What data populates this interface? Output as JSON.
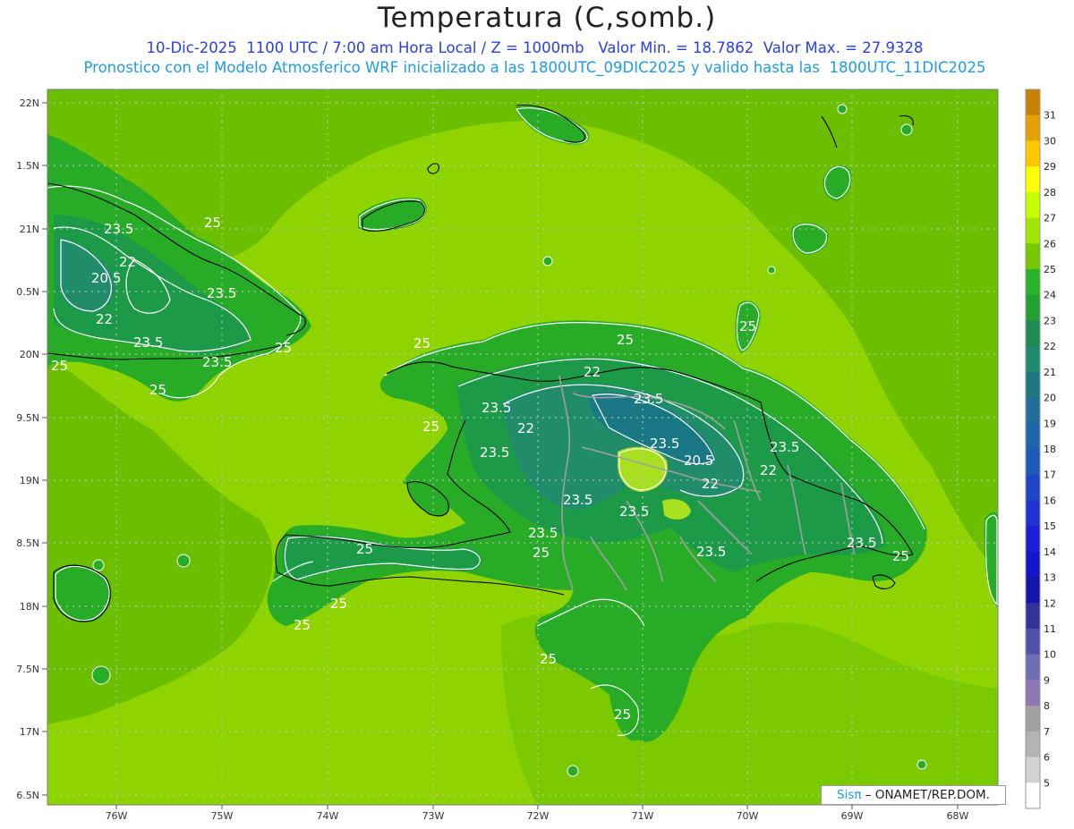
{
  "header": {
    "title": "Temperatura (C,somb.)",
    "line1": "10-Dic-2025  1100 UTC / 7:00 am Hora Local / Z = 1000mb   Valor Min. = 18.7862  Valor Max. = 27.9328",
    "line2": "Pronostico con el Modelo Atmosferico WRF inicializado a las 1800UTC_09DIC2025 y valido hasta las  1800UTC_11DIC2025"
  },
  "map": {
    "lat_labels": [
      "22N",
      "1.5N",
      "21N",
      "0.5N",
      "20N",
      "9.5N",
      "19N",
      "8.5N",
      "18N",
      "7.5N",
      "17N",
      "6.5N"
    ],
    "lon_labels": [
      "76W",
      "75W",
      "74W",
      "73W",
      "72W",
      "71W",
      "70W",
      "69W",
      "68W"
    ],
    "contour_labels": [
      "25",
      "23.5",
      "22",
      "20.5",
      "23.5",
      "22",
      "23.5",
      "25",
      "23.5",
      "25",
      "25",
      "25",
      "22",
      "23.5",
      "23.5",
      "22",
      "23.5",
      "25",
      "23.5",
      "20.5",
      "23.5",
      "22",
      "22",
      "23.5",
      "23.5",
      "23.5",
      "25",
      "25",
      "23.5",
      "25",
      "23.5",
      "25",
      "25",
      "25",
      "25",
      "25",
      "25"
    ],
    "colors": {
      "ocean": "#8fd400",
      "lowland": "#6cbf00",
      "land": "#28ac28",
      "cool": "#1d9a48",
      "mid": "#208c6a",
      "cold": "#1a7884",
      "warm": "#a8e020",
      "grid": "#c8c8c8",
      "coast": "#000000",
      "border": "#a0a0a0",
      "contour": "#ffffff"
    }
  },
  "colorbar": {
    "levels": [
      "31",
      "30",
      "29",
      "28",
      "27",
      "26",
      "25",
      "24",
      "23",
      "22",
      "21",
      "20",
      "19",
      "18",
      "17",
      "16",
      "15",
      "14",
      "13",
      "12",
      "11",
      "10",
      "9",
      "8",
      "7",
      "6",
      "5"
    ],
    "colors": [
      "#c88200",
      "#e6a000",
      "#ffc800",
      "#ffff00",
      "#c8ff00",
      "#a0e600",
      "#78c800",
      "#28b428",
      "#22a032",
      "#1e8c50",
      "#1e8c6e",
      "#1e7882",
      "#1e6e96",
      "#1e64aa",
      "#1e5ab9",
      "#1e46c8",
      "#1e32d2",
      "#1e1ed7",
      "#1414c8",
      "#1414aa",
      "#32329b",
      "#5050aa",
      "#6e6eb4",
      "#8c78b4",
      "#a0a0a0",
      "#b4b4b4",
      "#d2d2d2",
      "#ffffff"
    ]
  },
  "credit": {
    "brand": "Sisπ",
    "text": "– ONAMET/REP.DOM."
  }
}
